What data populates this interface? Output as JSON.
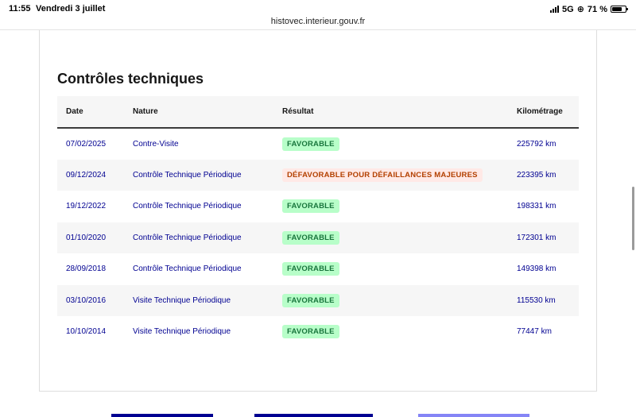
{
  "status": {
    "time": "11:55",
    "date": "Vendredi 3 juillet",
    "network": "5G",
    "battery": "71 %"
  },
  "browser": {
    "url": "histovec.interieur.gouv.fr"
  },
  "section": {
    "title": "Contrôles techniques"
  },
  "table": {
    "headers": {
      "date": "Date",
      "nature": "Nature",
      "result": "Résultat",
      "mileage": "Kilométrage"
    },
    "rows": [
      {
        "date": "07/02/2025",
        "nature": "Contre-Visite",
        "result": "FAVORABLE",
        "mileage": "225792 km"
      },
      {
        "date": "09/12/2024",
        "nature": "Contrôle Technique Périodique",
        "result": "DÉFAVORABLE POUR DÉFAILLANCES MAJEURES",
        "mileage": "223395 km"
      },
      {
        "date": "19/12/2022",
        "nature": "Contrôle Technique Périodique",
        "result": "FAVORABLE",
        "mileage": "198331 km"
      },
      {
        "date": "01/10/2020",
        "nature": "Contrôle Technique Périodique",
        "result": "FAVORABLE",
        "mileage": "172301 km"
      },
      {
        "date": "28/09/2018",
        "nature": "Contrôle Technique Périodique",
        "result": "FAVORABLE",
        "mileage": "149398 km"
      },
      {
        "date": "03/10/2016",
        "nature": "Visite Technique Périodique",
        "result": "FAVORABLE",
        "mileage": "115530 km"
      },
      {
        "date": "10/10/2014",
        "nature": "Visite Technique Périodique",
        "result": "FAVORABLE",
        "mileage": "77447 km"
      }
    ]
  },
  "colors": {
    "link_blue": "#000091",
    "favorable_bg": "#b8fec9",
    "favorable_text": "#18753c",
    "defavorable_bg": "#ffe9e6",
    "defavorable_text": "#b34000"
  }
}
